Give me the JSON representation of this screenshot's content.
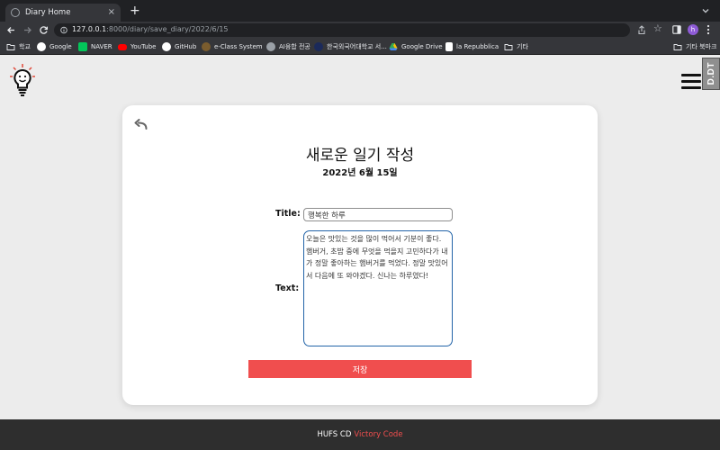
{
  "browser": {
    "tab_title": "Diary Home",
    "tab_close": "×",
    "new_tab": "+",
    "url_host": "127.0.0.1",
    "url_rest": ":8000/diary/save_diary/2022/6/15",
    "profile_initial": "h",
    "star": "☆",
    "bookmarks": [
      {
        "label": "학교",
        "icon": "folder-icon"
      },
      {
        "label": "Google",
        "icon": "google-icon"
      },
      {
        "label": "NAVER",
        "icon": "naver-icon"
      },
      {
        "label": "YouTube",
        "icon": "youtube-icon"
      },
      {
        "label": "GitHub",
        "icon": "github-icon"
      },
      {
        "label": "e-Class System",
        "icon": "eclass-icon"
      },
      {
        "label": "AI융합 전공",
        "icon": "globe-icon"
      },
      {
        "label": "한국외국어대학교 서...",
        "icon": "hufs-icon"
      },
      {
        "label": "Google Drive",
        "icon": "drive-icon"
      },
      {
        "label": "la Repubblica",
        "icon": "repubblica-icon"
      },
      {
        "label": "기타",
        "icon": "folder-icon"
      }
    ],
    "other_bookmarks": "기타 북마크"
  },
  "page": {
    "side_tab_label": "D.DT",
    "back_label": "",
    "title": "새로운 일기 작성",
    "date": "2022년 6월 15일",
    "form": {
      "title_label": "Title:",
      "title_value": "행복한 하루",
      "text_label": "Text:",
      "text_value": "오늘은 맛있는 것을 많이 먹어서 기분이 좋다. 햄버거, 초밥 중에 무엇을 먹을지 고민하다가 내가 정말 좋아하는 햄버거를 먹었다. 정말 맛있어서 다음에 또 와야겠다. 신나는 하루였다!",
      "save_label": "저장"
    }
  },
  "footer": {
    "text": "HUFS CD",
    "accent": "Victory Code"
  },
  "colors": {
    "accent": "#f04e4e",
    "textarea_border": "#2364a8",
    "footer_bg": "#2e2e2e"
  }
}
